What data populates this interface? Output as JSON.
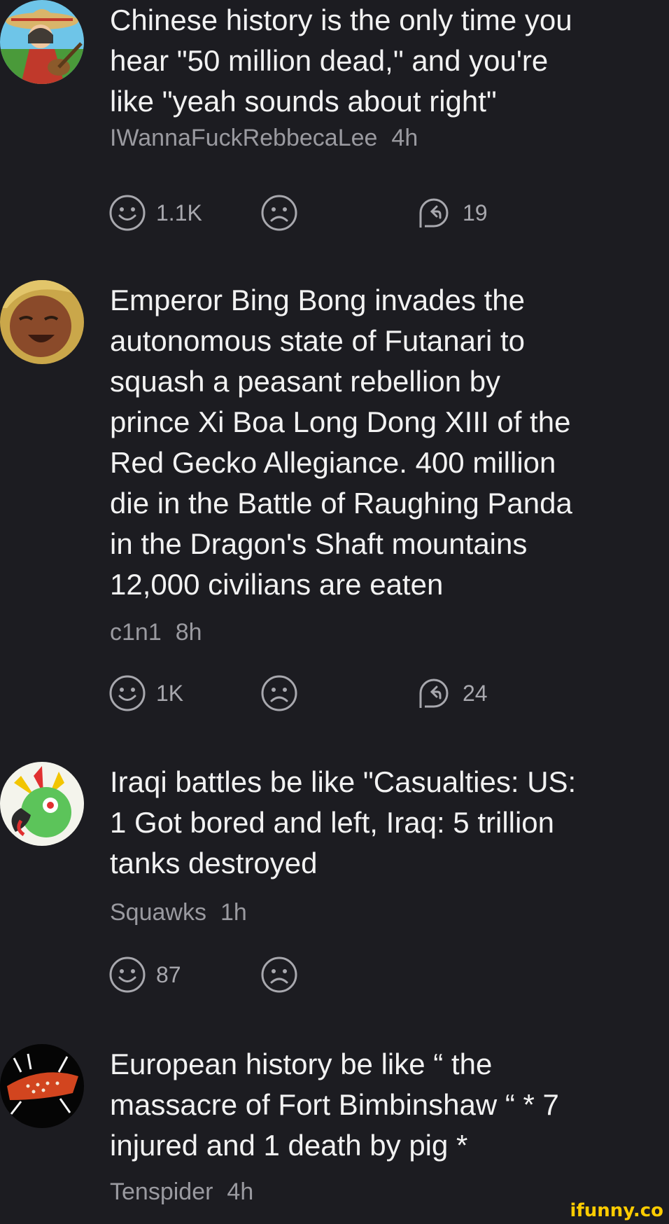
{
  "comments": [
    {
      "text": "Chinese history is the only time you\nhear \"50 million dead,\" and you're\nlike \"yeah sounds about right\"",
      "username": "IWannaFuckRebbecaLee",
      "time": "4h",
      "smiles": "1.1K",
      "replies": "19",
      "avatar_icon": "sombrero-guitar-avatar"
    },
    {
      "text": "Emperor Bing Bong invades the\nautonomous state of Futanari to\nsquash a peasant rebellion by\nprince Xi Boa Long Dong XIII of the\nRed Gecko Allegiance. 400 million\ndie in the Battle of Raughing Panda\nin the Dragon's Shaft mountains\n12,000 civilians are eaten",
      "username": "c1n1",
      "time": "8h",
      "smiles": "1K",
      "replies": "24",
      "avatar_icon": "laughing-man-avatar"
    },
    {
      "text": "Iraqi battles be like \"Casualties: US:\n1 Got bored and left, Iraq: 5 trillion\ntanks destroyed",
      "username": "Squawks",
      "time": "1h",
      "smiles": "87",
      "avatar_icon": "parrot-avatar"
    },
    {
      "text": "European history be like “ the\nmassacre of Fort Bimbinshaw “ * 7\ninjured and 1 death by pig *",
      "username": "Tenspider",
      "time": "4h",
      "avatar_icon": "spider-avatar"
    }
  ],
  "watermark": "ifunny.co",
  "colors": {
    "background": "#1c1c21",
    "text": "#f2f2f2",
    "meta": "#9a9aa0",
    "watermark": "#ffcc00"
  }
}
